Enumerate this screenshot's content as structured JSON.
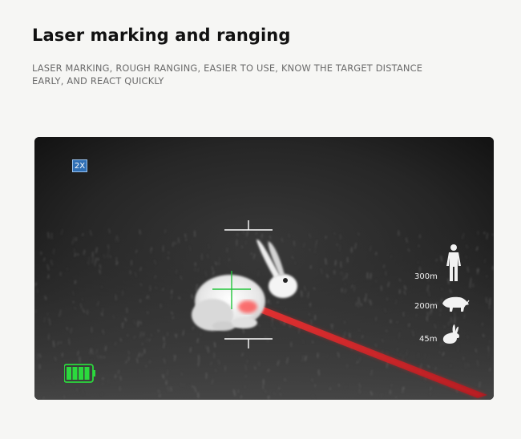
{
  "header": {
    "title": "Laser marking and ranging",
    "subtitle": "LASER MARKING, ROUGH RANGING, EASIER TO USE, KNOW THE TARGET DISTANCE EARLY, AND REACT QUICKLY"
  },
  "scope": {
    "zoom_label": "2X",
    "battery_icon": "battery-full-icon",
    "reticle_color": "#22c43a",
    "laser_color": "#e0202a",
    "ranging_targets": [
      {
        "distance": "300m",
        "icon": "human-icon"
      },
      {
        "distance": "200m",
        "icon": "boar-icon"
      },
      {
        "distance": "45m",
        "icon": "rabbit-icon"
      }
    ]
  }
}
